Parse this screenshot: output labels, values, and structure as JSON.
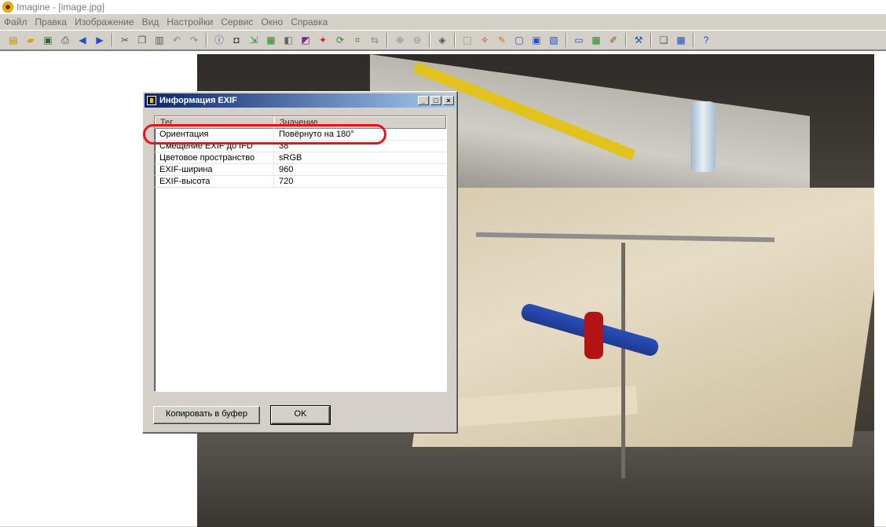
{
  "app": {
    "title": "Imagine - [image.jpg]"
  },
  "menu": [
    "Файл",
    "Правка",
    "Изображение",
    "Вид",
    "Настройки",
    "Сервис",
    "Окно",
    "Справка"
  ],
  "toolbar": {
    "groups": [
      [
        "new-file-icon",
        "open-folder-icon",
        "save-icon",
        "print-icon",
        "back-arrow-icon",
        "forward-arrow-icon"
      ],
      [
        "cut-icon",
        "copy-icon",
        "paste-icon",
        "undo-icon",
        "redo-icon"
      ],
      [
        "info-icon",
        "camera-icon",
        "resize-icon",
        "print-preview-icon",
        "grayscale-icon",
        "color-balance-icon",
        "color-effects-icon",
        "rotate-icon",
        "crop-icon",
        "flip-icon"
      ],
      [
        "zoom-in-icon",
        "zoom-out-icon"
      ],
      [
        "slideshow-icon"
      ],
      [
        "select-icon",
        "effects-icon",
        "magic-wand-icon",
        "fit-window-icon",
        "actual-size-icon",
        "full-screen-icon"
      ],
      [
        "monitor-icon",
        "thumbnail-icon",
        "edit-icon"
      ],
      [
        "tools-icon"
      ],
      [
        "batch-icon",
        "screen-capture-icon"
      ],
      [
        "help-icon"
      ]
    ]
  },
  "dialog": {
    "title": "Информация EXIF",
    "controls": {
      "minimize": "_",
      "maximize": "□",
      "close": "×"
    },
    "columns": [
      "Тег",
      "Значение"
    ],
    "rows": [
      {
        "tag": "Ориентация",
        "value": "Повёрнуто на 180°"
      },
      {
        "tag": "Смещение EXIF до IFD",
        "value": "38"
      },
      {
        "tag": "Цветовое пространство",
        "value": "sRGB"
      },
      {
        "tag": "EXIF-ширина",
        "value": "960"
      },
      {
        "tag": "EXIF-высота",
        "value": "720"
      }
    ],
    "copy_button": "Копировать в буфер",
    "ok_button": "OK"
  },
  "colors": {
    "dialog_title_start": "#0a246a",
    "dialog_title_end": "#a6caf0",
    "highlight_ring": "#e8141a"
  }
}
